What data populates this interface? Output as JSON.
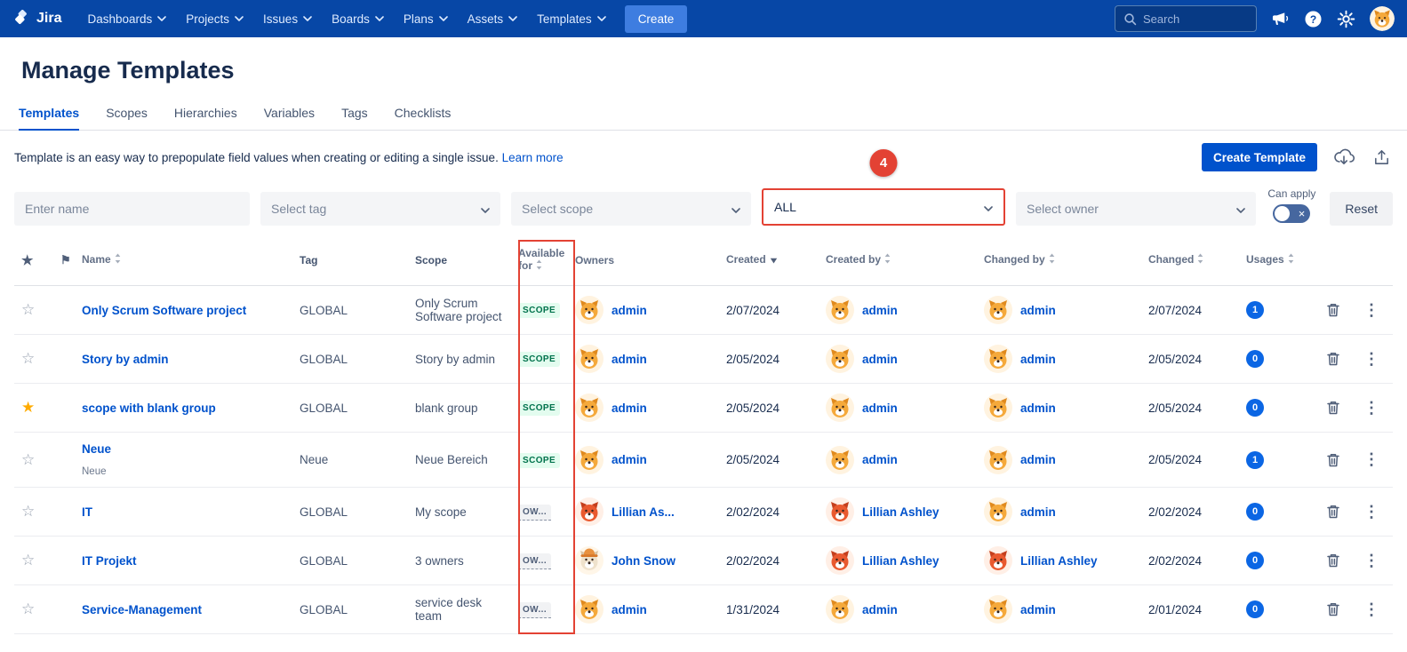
{
  "colors": {
    "navbar_bg": "#0747A6",
    "nav_create_blue": "#3E7DE0",
    "link_blue": "#0052CC",
    "create_button_blue": "#0052CC",
    "annotation_red": "#E34234",
    "scope_badge_green": "#00724C",
    "usages_badge_blue": "#0B66E4",
    "star_yellow": "#FFAB00"
  },
  "navbar": {
    "brand": "Jira",
    "menu": [
      {
        "label": "Dashboards"
      },
      {
        "label": "Projects"
      },
      {
        "label": "Issues"
      },
      {
        "label": "Boards"
      },
      {
        "label": "Plans"
      },
      {
        "label": "Assets"
      },
      {
        "label": "Templates"
      }
    ],
    "create_label": "Create",
    "search_placeholder": "Search"
  },
  "page": {
    "title": "Manage Templates",
    "tabs": [
      {
        "label": "Templates",
        "active": true
      },
      {
        "label": "Scopes",
        "active": false
      },
      {
        "label": "Hierarchies",
        "active": false
      },
      {
        "label": "Variables",
        "active": false
      },
      {
        "label": "Tags",
        "active": false
      },
      {
        "label": "Checklists",
        "active": false
      }
    ],
    "description": "Template is an easy way to prepopulate field values when creating or editing a single issue.",
    "learn_more_label": "Learn more",
    "create_template_label": "Create Template"
  },
  "filters": {
    "name_placeholder": "Enter name",
    "tag_placeholder": "Select tag",
    "scope_placeholder": "Select scope",
    "available_for_value": "ALL",
    "owner_placeholder": "Select owner",
    "can_apply_label": "Can apply",
    "reset_label": "Reset"
  },
  "annotations": {
    "step_badge": "4"
  },
  "table": {
    "columns": [
      {
        "key": "star",
        "label": ""
      },
      {
        "key": "flag",
        "label": ""
      },
      {
        "key": "name",
        "label": "Name",
        "sort": "both"
      },
      {
        "key": "tag",
        "label": "Tag"
      },
      {
        "key": "scope",
        "label": "Scope"
      },
      {
        "key": "available_for",
        "label": "Available for",
        "sort": "both"
      },
      {
        "key": "owners",
        "label": "Owners"
      },
      {
        "key": "created",
        "label": "Created",
        "sort": "desc"
      },
      {
        "key": "created_by",
        "label": "Created by",
        "sort": "both"
      },
      {
        "key": "changed_by",
        "label": "Changed by",
        "sort": "both"
      },
      {
        "key": "changed",
        "label": "Changed",
        "sort": "both"
      },
      {
        "key": "usages",
        "label": "Usages",
        "sort": "both"
      },
      {
        "key": "delete",
        "label": ""
      },
      {
        "key": "menu",
        "label": ""
      }
    ],
    "rows": [
      {
        "starred": false,
        "name": "Only Scrum Software project",
        "subname": "",
        "tag": "GLOBAL",
        "scope": "Only Scrum Software project",
        "available_for": "SCOPE",
        "available_type": "scope",
        "owner": {
          "name": "admin",
          "avatar": "dog-yellow"
        },
        "created": "2/07/2024",
        "created_by": {
          "name": "admin",
          "avatar": "dog-yellow"
        },
        "changed_by": {
          "name": "admin",
          "avatar": "dog-yellow"
        },
        "changed": "2/07/2024",
        "usages": "1"
      },
      {
        "starred": false,
        "name": "Story by admin",
        "subname": "",
        "tag": "GLOBAL",
        "scope": "Story by admin",
        "available_for": "SCOPE",
        "available_type": "scope",
        "owner": {
          "name": "admin",
          "avatar": "dog-yellow"
        },
        "created": "2/05/2024",
        "created_by": {
          "name": "admin",
          "avatar": "dog-yellow"
        },
        "changed_by": {
          "name": "admin",
          "avatar": "dog-yellow"
        },
        "changed": "2/05/2024",
        "usages": "0"
      },
      {
        "starred": true,
        "name": "scope with blank group",
        "subname": "",
        "tag": "GLOBAL",
        "scope": "blank group",
        "available_for": "SCOPE",
        "available_type": "scope",
        "owner": {
          "name": "admin",
          "avatar": "dog-yellow"
        },
        "created": "2/05/2024",
        "created_by": {
          "name": "admin",
          "avatar": "dog-yellow"
        },
        "changed_by": {
          "name": "admin",
          "avatar": "dog-yellow"
        },
        "changed": "2/05/2024",
        "usages": "0"
      },
      {
        "starred": false,
        "name": "Neue",
        "subname": "Neue",
        "tag": "Neue",
        "scope": "Neue Bereich",
        "available_for": "SCOPE",
        "available_type": "scope",
        "owner": {
          "name": "admin",
          "avatar": "dog-yellow"
        },
        "created": "2/05/2024",
        "created_by": {
          "name": "admin",
          "avatar": "dog-yellow"
        },
        "changed_by": {
          "name": "admin",
          "avatar": "dog-yellow"
        },
        "changed": "2/05/2024",
        "usages": "1"
      },
      {
        "starred": false,
        "name": "IT",
        "subname": "",
        "tag": "GLOBAL",
        "scope": "My scope",
        "available_for": "OW...",
        "available_type": "owner",
        "owner": {
          "name": "Lillian As...",
          "avatar": "dog-orange"
        },
        "created": "2/02/2024",
        "created_by": {
          "name": "Lillian Ashley",
          "avatar": "dog-orange"
        },
        "changed_by": {
          "name": "admin",
          "avatar": "dog-yellow"
        },
        "changed": "2/02/2024",
        "usages": "0"
      },
      {
        "starred": false,
        "name": "IT Projekt",
        "subname": "",
        "tag": "GLOBAL",
        "scope": "3 owners",
        "available_for": "OW...",
        "available_type": "owner",
        "owner": {
          "name": "John Snow",
          "avatar": "dog-hat"
        },
        "created": "2/02/2024",
        "created_by": {
          "name": "Lillian Ashley",
          "avatar": "dog-orange"
        },
        "changed_by": {
          "name": "Lillian Ashley",
          "avatar": "dog-orange"
        },
        "changed": "2/02/2024",
        "usages": "0"
      },
      {
        "starred": false,
        "name": "Service-Management",
        "subname": "",
        "tag": "GLOBAL",
        "scope": "service desk team",
        "available_for": "OW...",
        "available_type": "owner",
        "owner": {
          "name": "admin",
          "avatar": "dog-yellow"
        },
        "created": "1/31/2024",
        "created_by": {
          "name": "admin",
          "avatar": "dog-yellow"
        },
        "changed_by": {
          "name": "admin",
          "avatar": "dog-yellow"
        },
        "changed": "2/01/2024",
        "usages": "0"
      }
    ]
  }
}
